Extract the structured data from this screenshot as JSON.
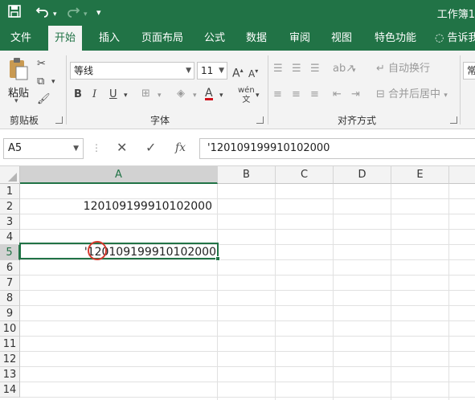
{
  "window": {
    "title": "工作簿1"
  },
  "tabs": [
    "文件",
    "开始",
    "插入",
    "页面布局",
    "公式",
    "数据",
    "审阅",
    "视图",
    "特色功能",
    "告诉我"
  ],
  "active_tab": "开始",
  "ribbon": {
    "clipboard": {
      "paste_label": "粘贴",
      "group_label": "剪贴板"
    },
    "font": {
      "font_name": "等线",
      "font_size": "11",
      "group_label": "字体"
    },
    "alignment": {
      "wrap_label": "自动换行",
      "merge_label": "合并后居中",
      "group_label": "对齐方式"
    },
    "number": {
      "format_partial": "常"
    }
  },
  "formula_bar": {
    "name_box": "A5",
    "formula": "'120109199910102000"
  },
  "columns": [
    "A",
    "B",
    "C",
    "D",
    "E"
  ],
  "rows": [
    "1",
    "2",
    "3",
    "4",
    "5",
    "6",
    "7",
    "8",
    "9",
    "10",
    "11",
    "12",
    "13",
    "14"
  ],
  "cells": {
    "A2": "120109199910102000",
    "A5": "'120109199910102000"
  },
  "selected_cell": "A5",
  "colors": {
    "excel_green": "#217346",
    "annotation_red": "#d63a2f"
  }
}
